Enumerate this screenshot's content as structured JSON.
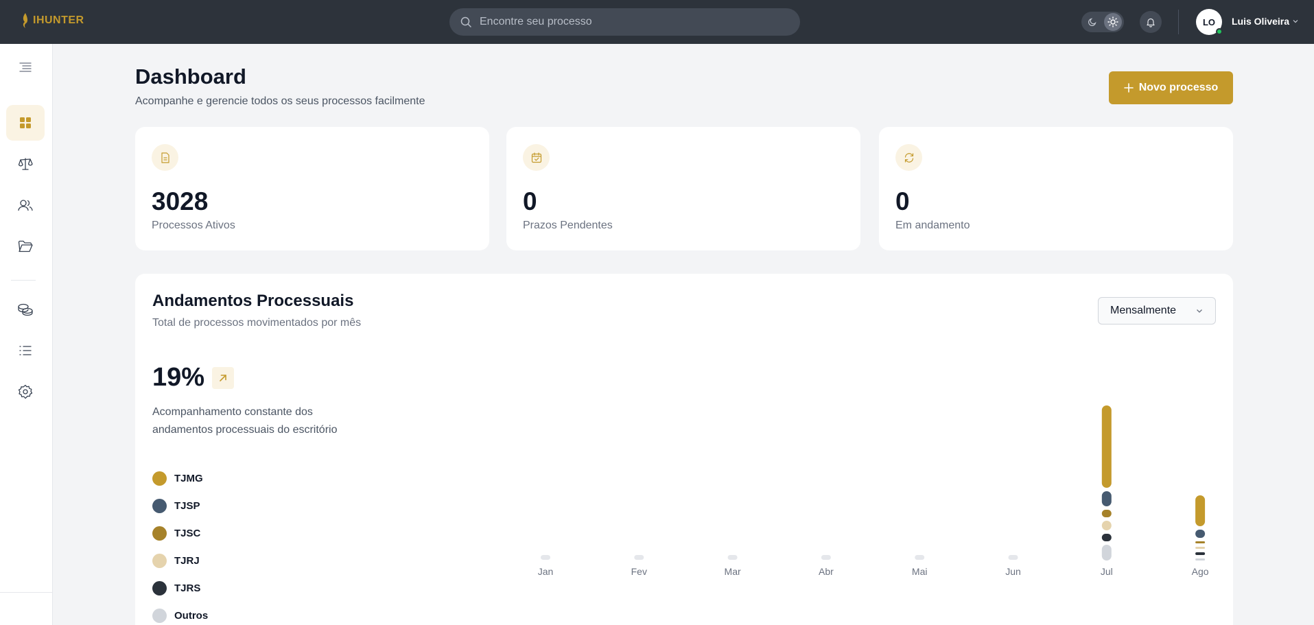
{
  "app": {
    "brand": "IHUNTER",
    "search_placeholder": "Encontre seu processo",
    "user": {
      "initials": "LO",
      "name": "Luis Oliveira"
    }
  },
  "sidebar": {
    "items": [
      {
        "icon": "menu-collapse-icon"
      },
      {
        "icon": "dashboard-icon",
        "active": true
      },
      {
        "icon": "scale-icon"
      },
      {
        "icon": "users-icon"
      },
      {
        "icon": "folder-icon"
      },
      {
        "icon": "coins-icon"
      },
      {
        "icon": "list-icon"
      },
      {
        "icon": "gear-icon"
      }
    ]
  },
  "header": {
    "title": "Dashboard",
    "subtitle": "Acompanhe e gerencie todos os seus processos facilmente",
    "new_button": "Novo processo"
  },
  "stats": [
    {
      "icon": "document-icon",
      "value": "3028",
      "label": "Processos Ativos"
    },
    {
      "icon": "calendar-check-icon",
      "value": "0",
      "label": "Prazos Pendentes"
    },
    {
      "icon": "refresh-icon",
      "value": "0",
      "label": "Em andamento"
    }
  ],
  "panel": {
    "title": "Andamentos Processuais",
    "subtitle": "Total de processos movimentados por mês",
    "period": "Mensalmente",
    "percent": "19%",
    "description": "Acompanhamento constante dos andamentos processuais do escritório"
  },
  "colors": {
    "accent": "#c49a2c",
    "TJMG": "#c49a2c",
    "TJSP": "#465a70",
    "TJSC": "#a6822a",
    "TJRJ": "#e5d3ad",
    "TJRS": "#2b323b",
    "Outros": "#d1d5db"
  },
  "chart_data": {
    "type": "bar",
    "stacked": true,
    "categories": [
      "Jan",
      "Fev",
      "Mar",
      "Abr",
      "Mai",
      "Jun",
      "Jul",
      "Ago"
    ],
    "series": [
      {
        "name": "TJMG",
        "values": [
          0,
          0,
          0,
          0,
          0,
          0,
          120,
          45
        ]
      },
      {
        "name": "TJSP",
        "values": [
          0,
          0,
          0,
          0,
          0,
          0,
          22,
          12
        ]
      },
      {
        "name": "TJSC",
        "values": [
          0,
          0,
          0,
          0,
          0,
          0,
          11,
          2
        ]
      },
      {
        "name": "TJRJ",
        "values": [
          0,
          0,
          0,
          0,
          0,
          0,
          14,
          2
        ]
      },
      {
        "name": "TJRS",
        "values": [
          0,
          0,
          0,
          0,
          0,
          0,
          11,
          4
        ]
      },
      {
        "name": "Outros",
        "values": [
          0,
          0,
          0,
          0,
          0,
          0,
          23,
          3
        ]
      }
    ],
    "grid": false,
    "legend": "left"
  }
}
